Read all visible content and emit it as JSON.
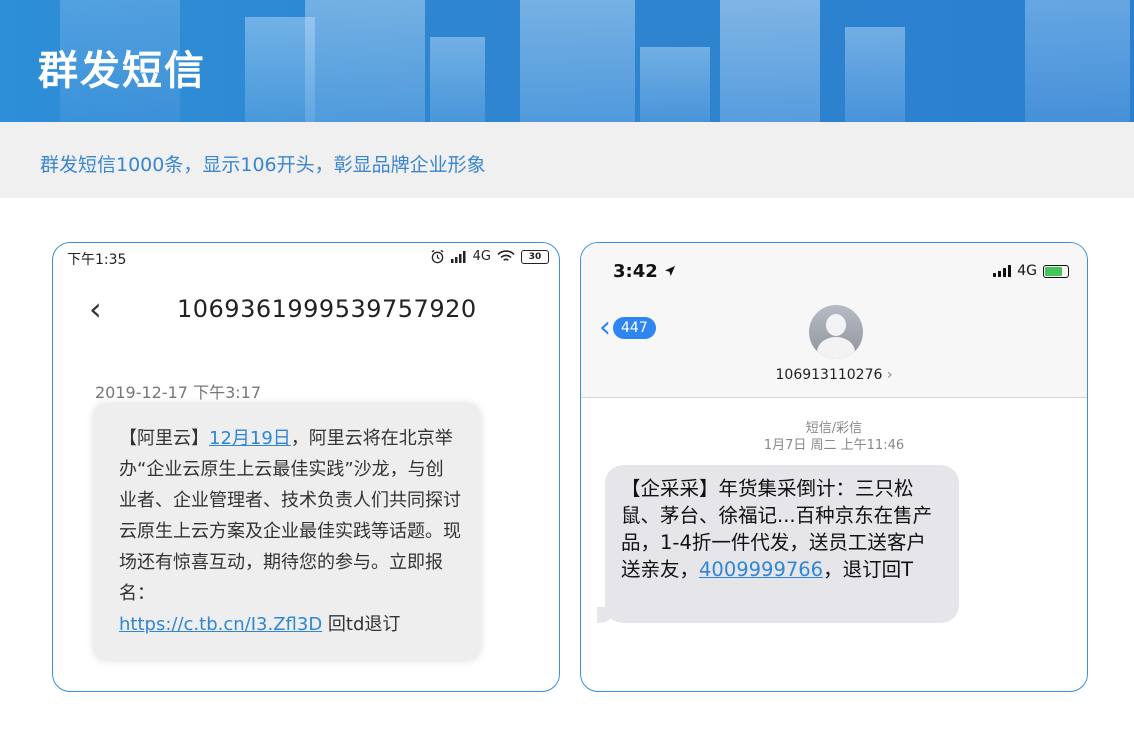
{
  "banner": {
    "title": "群发短信"
  },
  "subtitle": "群发短信1000条，显示106开头，彰显品牌企业形象",
  "android": {
    "status_time": "下午1:35",
    "status_network": "4G",
    "battery": "30",
    "sender_number": "1069361999539757920",
    "timestamp": "2019-12-17 下午3:17",
    "message_prefix": "【阿里云】",
    "message_date_link": "12月19日",
    "message_body": "，阿里云将在北京举办“企业云原生上云最佳实践”沙龙，与创业者、企业管理者、技术负责人们共同探讨云原生上云方案及企业最佳实践等话题。现场还有惊喜互动，期待您的参与。立即报名：",
    "message_link": "https://c.tb.cn/I3.Zfl3D",
    "message_suffix": " 回td退订"
  },
  "ios": {
    "status_time": "3:42",
    "status_network": "4G",
    "back_count": "447",
    "sender_number": "106913110276",
    "message_type": "短信/彩信",
    "message_time": "1月7日 周二 上午11:46",
    "message_body": "【企采采】年货集采倒计：三只松鼠、茅台、徐福记...百种京东在售产品，1-4折一件代发，送员工送客户送亲友，",
    "message_link": "4009999766",
    "message_suffix": "，退订回T"
  }
}
